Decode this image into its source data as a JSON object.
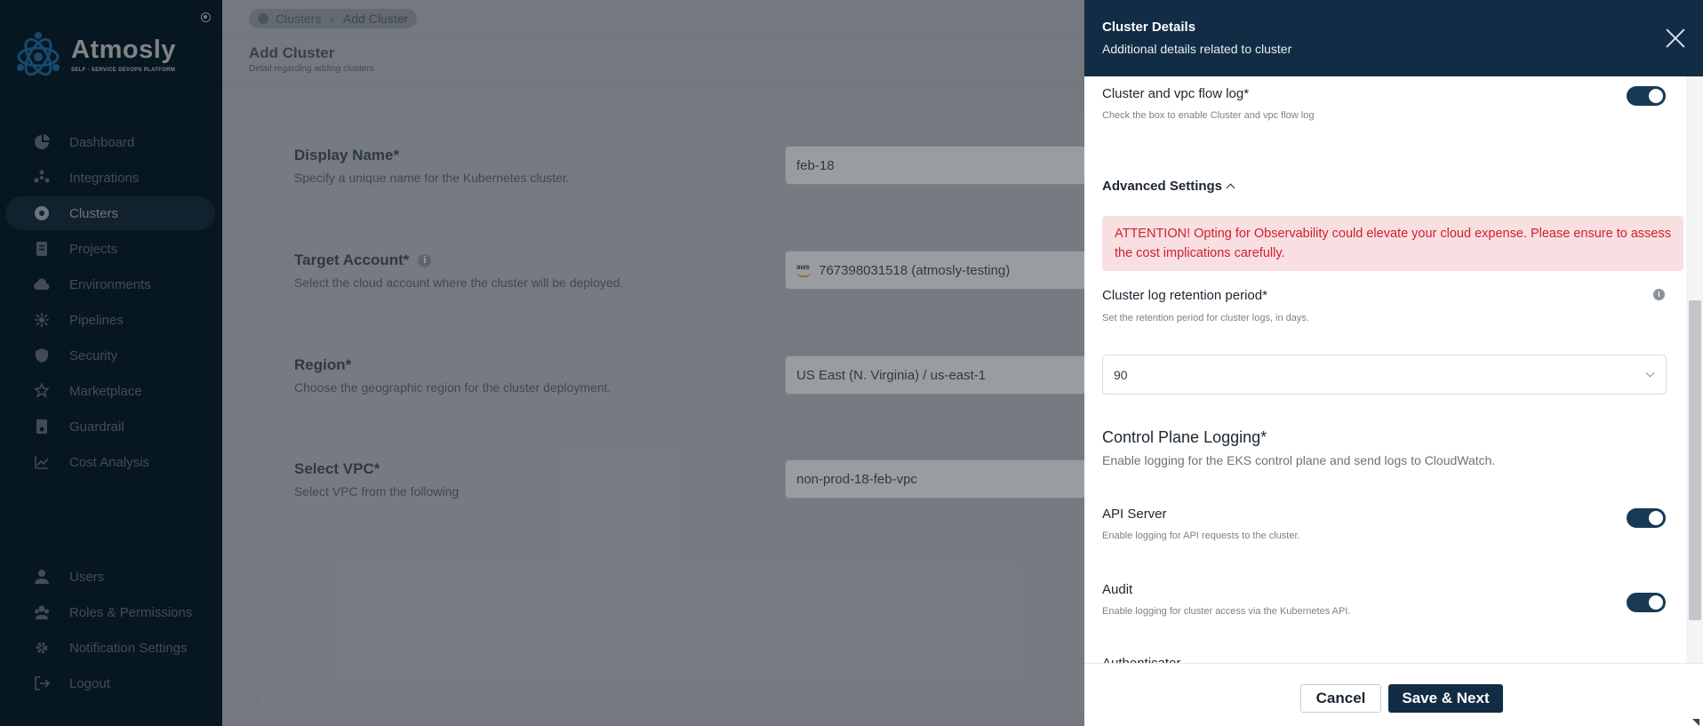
{
  "sidebar": {
    "brand": {
      "name": "Atmosly",
      "tagline": "SELF - SERVICE DEVOPS PLATFORM"
    },
    "nav_items": [
      {
        "label": "Dashboard",
        "icon": "pie-chart-icon"
      },
      {
        "label": "Integrations",
        "icon": "integrations-icon"
      },
      {
        "label": "Clusters",
        "icon": "cluster-icon",
        "active": true
      },
      {
        "label": "Projects",
        "icon": "projects-icon"
      },
      {
        "label": "Environments",
        "icon": "cloud-icon"
      },
      {
        "label": "Pipelines",
        "icon": "pipelines-icon"
      },
      {
        "label": "Security",
        "icon": "shield-icon"
      },
      {
        "label": "Marketplace",
        "icon": "marketplace-icon"
      },
      {
        "label": "Guardrail",
        "icon": "guardrail-icon"
      },
      {
        "label": "Cost Analysis",
        "icon": "cost-icon"
      }
    ],
    "bottom_items": [
      {
        "label": "Users",
        "icon": "user-icon"
      },
      {
        "label": "Roles & Permissions",
        "icon": "roles-icon"
      },
      {
        "label": "Notification Settings",
        "icon": "gear-icon"
      },
      {
        "label": "Logout",
        "icon": "logout-icon"
      }
    ]
  },
  "main": {
    "breadcrumb": {
      "parent": "Clusters",
      "current": "Add Cluster"
    },
    "title": "Add Cluster",
    "subtitle": "Detail regarding adding clusters",
    "fields": [
      {
        "label": "Display Name*",
        "help": "Specify a unique name for the Kubernetes cluster.",
        "value": "feb-18"
      },
      {
        "label": "Target Account*",
        "help": "Select the cloud account where the cluster will be deployed.",
        "value": "767398031518 (atmosly-testing)",
        "provider": "aws"
      },
      {
        "label": "Region*",
        "help": "Choose the geographic region for the cluster deployment.",
        "value": "US East (N. Virginia) / us-east-1"
      },
      {
        "label": "Select VPC*",
        "help": "Select VPC from the following",
        "value": "non-prod-18-feb-vpc"
      }
    ]
  },
  "drawer": {
    "title": "Cluster Details",
    "subtitle": "Additional details related to cluster",
    "flow_log": {
      "label": "Cluster and vpc flow log*",
      "help": "Check the box to enable Cluster and vpc flow log",
      "enabled": true
    },
    "advanced_label": "Advanced Settings",
    "alert": "ATTENTION! Opting for Observability could elevate your cloud expense. Please ensure to assess the cost implications carefully.",
    "retention": {
      "label": "Cluster log retention period*",
      "help": "Set the retention period for cluster logs, in days.",
      "value": "90"
    },
    "control_plane": {
      "title": "Control Plane Logging*",
      "help": "Enable logging for the EKS control plane and send logs to CloudWatch.",
      "items": [
        {
          "label": "API Server",
          "help": "Enable logging for API requests to the cluster.",
          "enabled": true
        },
        {
          "label": "Audit",
          "help": "Enable logging for cluster access via the Kubernetes API.",
          "enabled": true
        }
      ],
      "partial_next": "Authenticator"
    },
    "cancel_label": "Cancel",
    "save_label": "Save & Next"
  },
  "colors": {
    "brand_navy": "#112c44",
    "alert_text": "#d21f2f",
    "alert_bg": "#f8dfe1",
    "sidebar_bg": "#0e2a3c"
  }
}
